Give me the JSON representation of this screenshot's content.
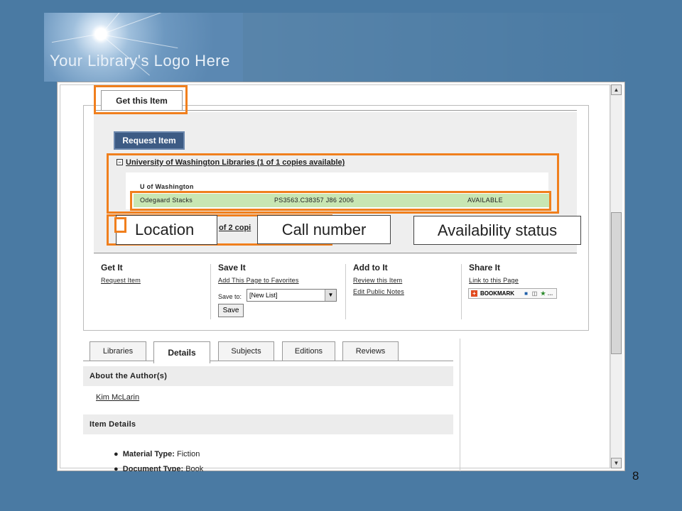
{
  "logo": {
    "text": "Your Library's Logo Here"
  },
  "top_tab": {
    "label": "Get this Item"
  },
  "request_button": "Request Item",
  "holdings": {
    "library_link": "University of Washington Libraries (1 of 1 copies available)",
    "header": "U of Washington",
    "row": {
      "location": "Odegaard Stacks",
      "call_number": "PS3563.C38357 J86 2006",
      "status": "AVAILABLE"
    },
    "second_link_fragment": "of 2 copi"
  },
  "callouts": {
    "location": "Location",
    "call_number": "Call number",
    "availability": "Availability status"
  },
  "actions": {
    "get_it": {
      "title": "Get It",
      "links": [
        "Request Item"
      ]
    },
    "save_it": {
      "title": "Save It",
      "links": [
        "Add This Page to Favorites"
      ],
      "save_to_label": "Save to:",
      "save_to_value": "[New List]",
      "save_button": "Save"
    },
    "add_to_it": {
      "title": "Add to It",
      "links": [
        "Review this Item",
        "Edit Public Notes"
      ]
    },
    "share_it": {
      "title": "Share It",
      "links": [
        "Link to this Page"
      ],
      "bookmark": "BOOKMARK"
    }
  },
  "lower_tabs": [
    "Libraries",
    "Details",
    "Subjects",
    "Editions",
    "Reviews"
  ],
  "sections": {
    "about_author": {
      "title": "About the Author(s)",
      "author": "Kim McLarin"
    },
    "item_details": {
      "title": "Item Details",
      "items": [
        {
          "label": "Material Type:",
          "value": "Fiction"
        },
        {
          "label": "Document Type:",
          "value": "Book"
        }
      ]
    }
  },
  "page_number": "8",
  "colors": {
    "background": "#4a7aa3",
    "annotation": "#f07f1d",
    "available_row": "#c8e6b3",
    "request_button": "#3d5b84"
  }
}
